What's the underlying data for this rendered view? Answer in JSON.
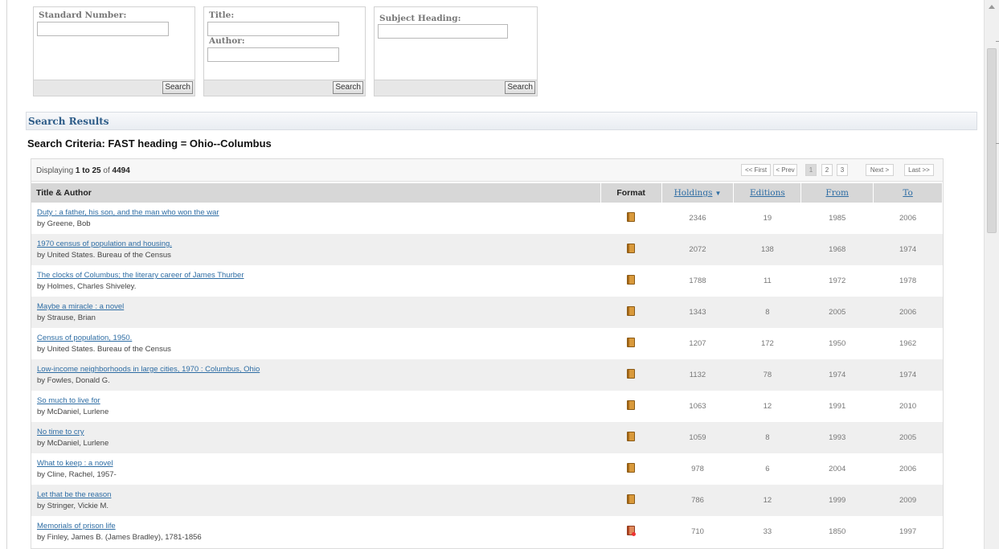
{
  "search_forms": {
    "standard": {
      "label": "Standard Number:",
      "value": "",
      "button": "Search"
    },
    "title_author": {
      "title_label": "Title:",
      "author_label": "Author:",
      "title_value": "",
      "author_value": "",
      "button": "Search"
    },
    "subject": {
      "label": "Subject Heading:",
      "value": "",
      "button": "Search"
    }
  },
  "results_header": "Search Results",
  "search_criteria": "Search Criteria: FAST heading = Ohio--Columbus",
  "displaying": {
    "prefix": "Displaying",
    "from": "1",
    "to_word": "to",
    "to": "25",
    "of_word": "of",
    "total": "4494"
  },
  "pager": {
    "first": "<< First",
    "prev": "< Prev",
    "pages": [
      "1",
      "2",
      "3"
    ],
    "current": "1",
    "next": "Next >",
    "last": "Last >>"
  },
  "columns": {
    "title_author": "Title & Author",
    "format": "Format",
    "holdings": "Holdings",
    "editions": "Editions",
    "from": "From",
    "to": "To"
  },
  "colors": {
    "link": "#2e6da4",
    "header_bg": "#d7d7d7",
    "alt_row": "#efefef"
  },
  "rows": [
    {
      "title": "Duty : a father, his son, and the man who won the war",
      "author": "by Greene, Bob",
      "format_icon": "book-icon",
      "holdings": "2346",
      "editions": "19",
      "from": "1985",
      "to": "2006"
    },
    {
      "title": "1970 census of population and housing.",
      "author": "by United States. Bureau of the Census",
      "format_icon": "book-icon",
      "holdings": "2072",
      "editions": "138",
      "from": "1968",
      "to": "1974"
    },
    {
      "title": "The clocks of Columbus; the literary career of James Thurber",
      "author": "by Holmes, Charles Shiveley.",
      "format_icon": "book-icon",
      "holdings": "1788",
      "editions": "11",
      "from": "1972",
      "to": "1978"
    },
    {
      "title": "Maybe a miracle : a novel",
      "author": "by Strause, Brian",
      "format_icon": "book-icon",
      "holdings": "1343",
      "editions": "8",
      "from": "2005",
      "to": "2006"
    },
    {
      "title": "Census of population, 1950.",
      "author": "by United States. Bureau of the Census",
      "format_icon": "book-icon",
      "holdings": "1207",
      "editions": "172",
      "from": "1950",
      "to": "1962"
    },
    {
      "title": "Low-income neighborhoods in large cities, 1970 : Columbus, Ohio",
      "author": "by Fowles, Donald G.",
      "format_icon": "book-icon",
      "holdings": "1132",
      "editions": "78",
      "from": "1974",
      "to": "1974"
    },
    {
      "title": "So much to live for",
      "author": "by McDaniel, Lurlene",
      "format_icon": "book-icon",
      "holdings": "1063",
      "editions": "12",
      "from": "1991",
      "to": "2010"
    },
    {
      "title": "No time to cry",
      "author": "by McDaniel, Lurlene",
      "format_icon": "book-icon",
      "holdings": "1059",
      "editions": "8",
      "from": "1993",
      "to": "2005"
    },
    {
      "title": "What to keep : a novel",
      "author": "by Cline, Rachel, 1957-",
      "format_icon": "book-icon",
      "holdings": "978",
      "editions": "6",
      "from": "2004",
      "to": "2006"
    },
    {
      "title": "Let that be the reason",
      "author": "by Stringer, Vickie M.",
      "format_icon": "book-icon",
      "holdings": "786",
      "editions": "12",
      "from": "1999",
      "to": "2009"
    },
    {
      "title": "Memorials of prison life",
      "author": "by Finley, James B. (James Bradley), 1781-1856",
      "format_icon": "book-digital-icon",
      "holdings": "710",
      "editions": "33",
      "from": "1850",
      "to": "1997"
    }
  ]
}
